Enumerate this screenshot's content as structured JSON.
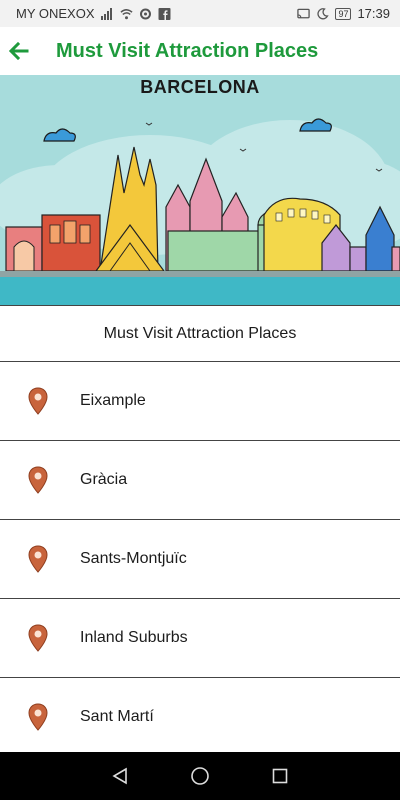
{
  "status_bar": {
    "carrier": "MY ONEXOX",
    "battery": "97",
    "time": "17:39"
  },
  "app_bar": {
    "title": "Must Visit Attraction Places",
    "back_icon": "arrow-left-icon"
  },
  "banner": {
    "city": "BARCELONA"
  },
  "list": {
    "header": "Must Visit Attraction Places",
    "items": [
      {
        "label": "Eixample"
      },
      {
        "label": "Gràcia"
      },
      {
        "label": "Sants-Montjuïc"
      },
      {
        "label": "Inland Suburbs"
      },
      {
        "label": "Sant Martí"
      }
    ]
  },
  "colors": {
    "accent": "#1e9a3c",
    "pin": "#c8643c",
    "sky": "#a7dcdc",
    "nav_bar": "#000000"
  }
}
